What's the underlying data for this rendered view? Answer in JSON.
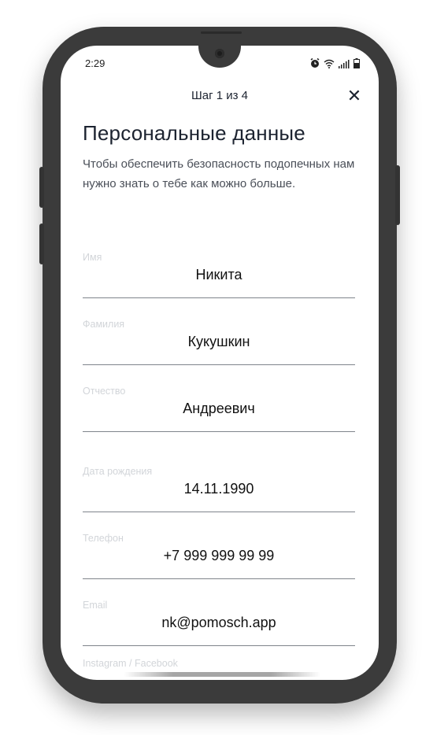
{
  "status_bar": {
    "time": "2:29",
    "icons": [
      "alarm-icon",
      "wifi-icon",
      "signal-icon",
      "battery-icon"
    ]
  },
  "header": {
    "step": "Шаг 1 из 4",
    "close_label": "✕"
  },
  "title": "Персональные данные",
  "subtitle": "Чтобы обеспечить безопасность подопечных нам нужно знать о тебе как можно больше.",
  "fields": [
    {
      "label": "Имя",
      "value": "Никита"
    },
    {
      "label": "Фамилия",
      "value": "Кукушкин"
    },
    {
      "label": "Отчество",
      "value": "Андреевич"
    },
    {
      "label": "Дата рождения",
      "value": "14.11.1990"
    },
    {
      "label": "Телефон",
      "value": "+7 999 999 99 99"
    },
    {
      "label": "Email",
      "value": "nk@pomosch.app"
    },
    {
      "label": "Instagram / Facebook",
      "value": ""
    }
  ]
}
